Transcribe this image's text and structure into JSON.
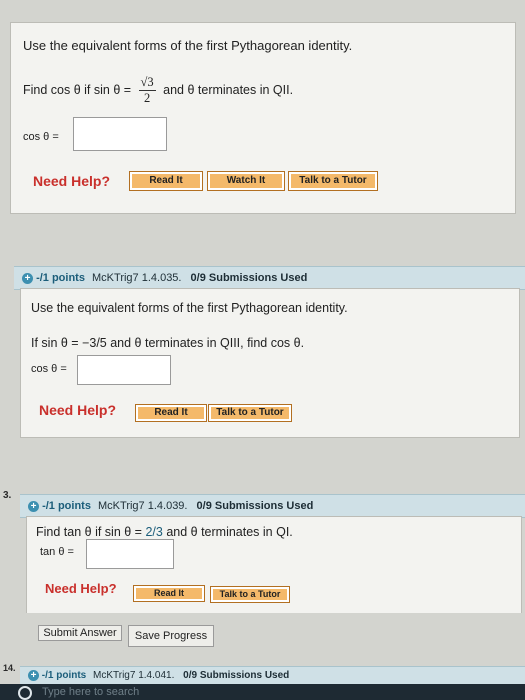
{
  "q13": {
    "question": "Use the equivalent forms of the first Pythagorean identity.",
    "find_prefix": "Find cos θ if sin θ =",
    "frac_num": "√3",
    "frac_den": "2",
    "find_suffix": "and θ terminates in QII.",
    "answer_label": "cos θ =",
    "answer_value": "",
    "need_help": "Need Help?",
    "read_it": "Read It",
    "watch_it": "Watch It",
    "talk_tutor": "Talk to a Tutor"
  },
  "q14": {
    "header_points": "-/1 points",
    "header_ref": "McKTrig7 1.4.035.",
    "header_submissions": "0/9 Submissions Used",
    "question": "Use the equivalent forms of the first Pythagorean identity.",
    "find_text": "If sin θ = −3/5 and θ terminates in QIII, find cos θ.",
    "answer_label": "cos θ =",
    "answer_value": "",
    "need_help": "Need Help?",
    "read_it": "Read It",
    "talk_tutor": "Talk to a Tutor"
  },
  "q15": {
    "number": "3.",
    "header_points": "-/1 points",
    "header_ref": "McKTrig7 1.4.039.",
    "header_submissions": "0/9 Submissions Used",
    "find_prefix": "Find tan θ if sin θ =",
    "find_value": "2/3",
    "find_suffix": "and θ terminates in QI.",
    "answer_label": "tan θ =",
    "answer_value": "",
    "need_help": "Need Help?",
    "read_it": "Read It",
    "talk_tutor": "Talk to a Tutor"
  },
  "actions": {
    "submit": "Submit Answer",
    "save": "Save Progress"
  },
  "q16": {
    "number": "14.",
    "header_points": "-/1 points",
    "header_ref": "McKTrig7 1.4.041.",
    "header_submissions": "0/9 Submissions Used"
  },
  "taskbar": {
    "search_placeholder": "Type here to search"
  },
  "colors": {
    "accent_header": "#cfe0e6",
    "need_help": "#c9302c",
    "button": "#f4b96a"
  }
}
